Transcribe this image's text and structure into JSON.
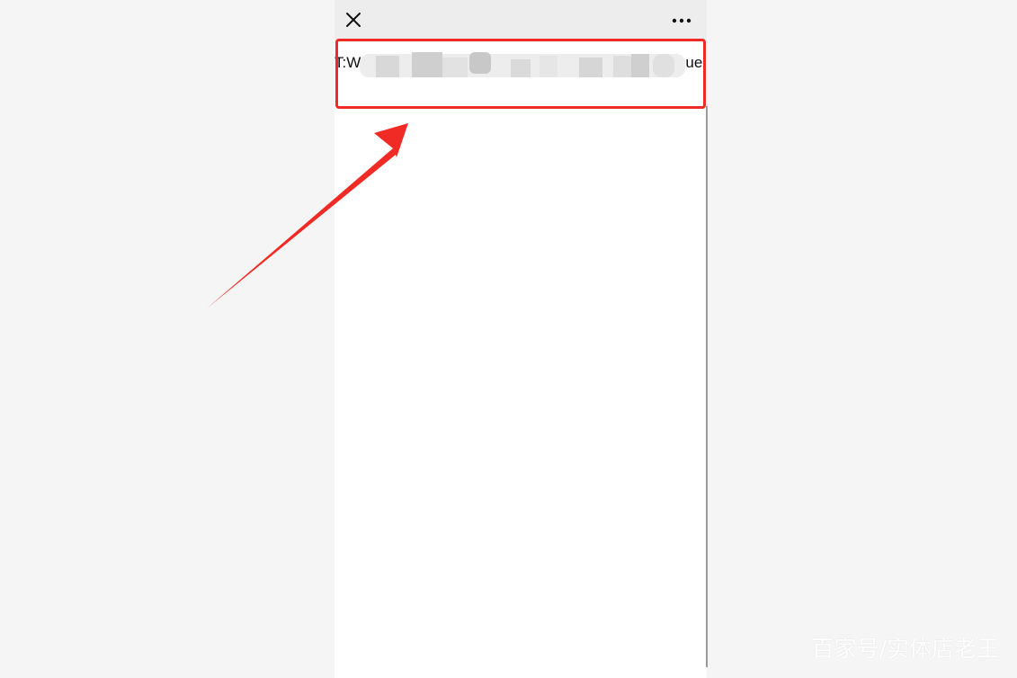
{
  "topbar": {
    "close_icon": "close-icon",
    "more_icon": "more-horizontal-icon",
    "background": "#ededed"
  },
  "content": {
    "text_start": "T:W",
    "text_end": "ue:"
  },
  "annotation": {
    "highlight_color": "#f02a25",
    "arrow_color": "#f02a25"
  },
  "watermark": {
    "text": "百家号/实体店老王"
  }
}
